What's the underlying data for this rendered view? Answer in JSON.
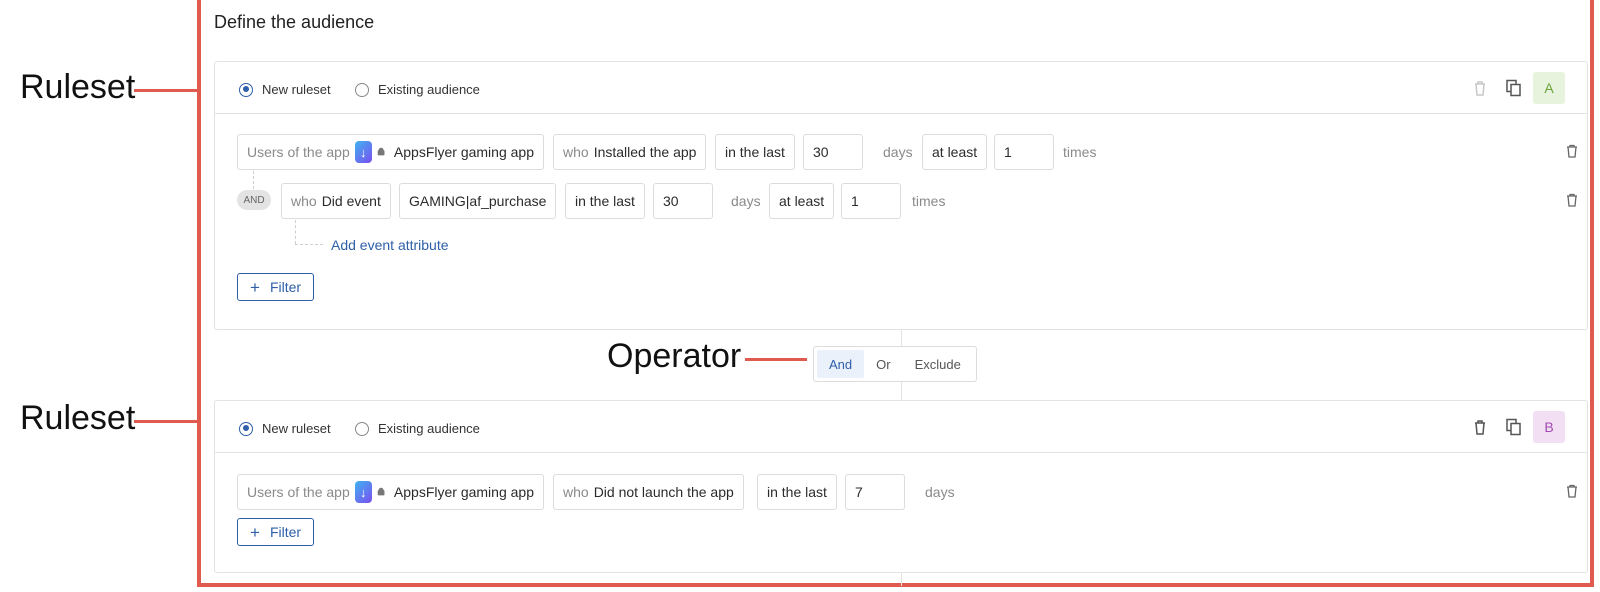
{
  "annotations": {
    "ruleset_label_1": "Ruleset",
    "ruleset_label_2": "Ruleset",
    "operator_label": "Operator"
  },
  "page": {
    "title": "Define the audience"
  },
  "rulesets": [
    {
      "radio_new": "New ruleset",
      "radio_existing": "Existing audience",
      "badge": "A",
      "badge_color": "#e7f3dc",
      "badge_text_color": "#6aa43a",
      "rule1": {
        "users_label": "Users of the app",
        "app_name": "AppsFlyer gaming app",
        "who_label": "who",
        "action": "Installed the app",
        "period": "in the last",
        "period_value": "30",
        "period_unit": "days",
        "freq": "at least",
        "freq_value": "1",
        "freq_unit": "times"
      },
      "rule2": {
        "and_label": "AND",
        "who_label": "who",
        "action": "Did event",
        "event": "GAMING|af_purchase",
        "period": "in the last",
        "period_value": "30",
        "period_unit": "days",
        "freq": "at least",
        "freq_value": "1",
        "freq_unit": "times",
        "add_attribute": "Add event attribute"
      },
      "filter_label": "Filter"
    },
    {
      "radio_new": "New ruleset",
      "radio_existing": "Existing audience",
      "badge": "B",
      "badge_color": "#f2dff4",
      "badge_text_color": "#a24bb0",
      "rule1": {
        "users_label": "Users of the app",
        "app_name": "AppsFlyer gaming app",
        "who_label": "who",
        "action": "Did not launch the app",
        "period": "in the last",
        "period_value": "7",
        "period_unit": "days"
      },
      "filter_label": "Filter"
    }
  ],
  "operator": {
    "options": [
      "And",
      "Or",
      "Exclude"
    ],
    "selected": "And"
  }
}
